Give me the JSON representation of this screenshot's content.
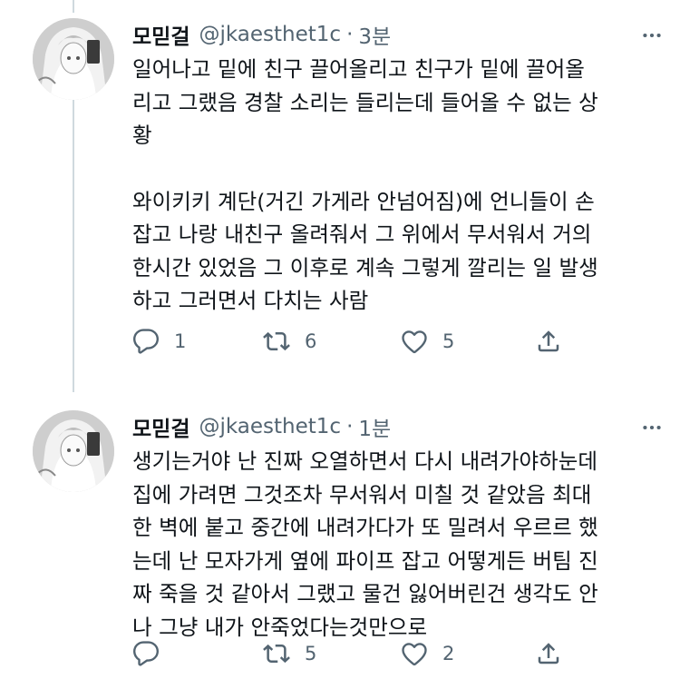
{
  "tweets": [
    {
      "author_name": "모믿걸",
      "handle": "@jkaesthet1c",
      "separator": "·",
      "time": "3분",
      "paragraphs": [
        "일어나고 밑에 친구 끌어올리고 친구가 밑에 끌어올\n리고 그랬음 경찰 소리는 들리는데 들어올 수 없는 상\n황",
        "와이키키 계단(거긴 가게라 안넘어짐)에 언니들이 손\n잡고 나랑 내친구 올려줘서 그 위에서 무서워서 거의\n한시간 있었음 그 이후로 계속 그렇게 깔리는 일 발생\n하고 그러면서 다치는 사람"
      ],
      "replies": "1",
      "retweets": "6",
      "likes": "5"
    },
    {
      "author_name": "모믿걸",
      "handle": "@jkaesthet1c",
      "separator": "·",
      "time": "1분",
      "paragraphs": [
        "생기는거야 난 진짜 오열하면서 다시 내려가야하눈데\n집에 가려면 그것조차 무서워서 미칠 것 같았음 최대\n한 벽에 붙고 중간에 내려가다가 또 밀려서 우르르 했\n는데 난 모자가게 옆에 파이프 잡고 어떻게든 버팀 진\n짜 죽을 것 같아서 그랬고 물건 잃어버린건 생각도 안\n나 그냥 내가 안죽었다는것만으로"
      ],
      "replies": "",
      "retweets": "5",
      "likes": "2"
    }
  ],
  "icons": {
    "reply": "reply-icon",
    "retweet": "retweet-icon",
    "like": "heart-icon",
    "share": "share-icon",
    "more": "more-icon"
  },
  "colors": {
    "text": "#0f1419",
    "secondary": "#536471",
    "thread_line": "#cfd9de"
  }
}
